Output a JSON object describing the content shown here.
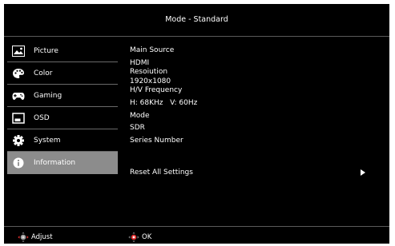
{
  "header": {
    "title": "Mode - Standard"
  },
  "sidebar": {
    "items": [
      {
        "label": "Picture",
        "icon": "picture-icon",
        "selected": false
      },
      {
        "label": "Color",
        "icon": "palette-icon",
        "selected": false
      },
      {
        "label": "Gaming",
        "icon": "gamepad-icon",
        "selected": false
      },
      {
        "label": "OSD",
        "icon": "osd-icon",
        "selected": false
      },
      {
        "label": "System",
        "icon": "gear-icon",
        "selected": false
      },
      {
        "label": "Information",
        "icon": "info-icon",
        "selected": true
      }
    ]
  },
  "info": {
    "main_source_label": "Main Source",
    "main_source_value": "HDMI",
    "resolution_label": "Resoiution",
    "resolution_value": "1920x1080",
    "hv_frequency_label": "H/V Frequency",
    "hv_frequency_value": "H: 68KHz   V: 60Hz",
    "mode_label": "Mode",
    "mode_value": "SDR",
    "series_number_label": "Series Number"
  },
  "reset": {
    "label": "Reset All Settings",
    "icon": "arrow-right-icon"
  },
  "footer": {
    "adjust_label": "Adjust",
    "adjust_icon": "joystick-left-right-icon",
    "ok_label": "OK",
    "ok_icon": "joystick-press-icon"
  },
  "colors": {
    "background": "#000000",
    "selected_item": "#8c8c8c",
    "divider": "#6a6a6a",
    "joystick_accent": "#e03030",
    "text": "#ffffff"
  }
}
